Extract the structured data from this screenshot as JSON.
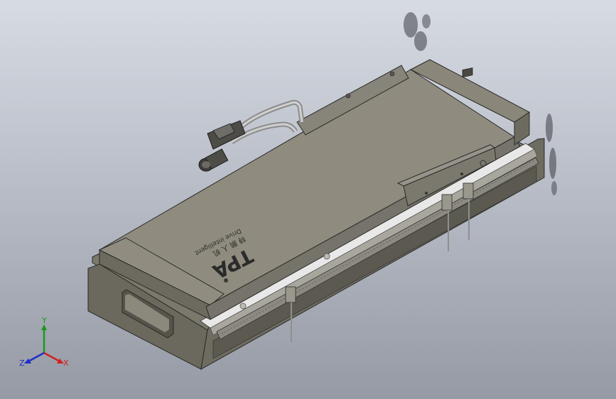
{
  "model": {
    "logo_lines": [
      "TPA",
      "特 鹏 人 机",
      "Drive intelligent"
    ],
    "colors": {
      "body_top": "#8f8c7f",
      "body_side": "#6d6a5f",
      "body_front": "#5d5a50",
      "rail": "#e6e6e6"
    }
  },
  "triad": {
    "x_label": "X",
    "y_label": "Y",
    "z_label": "Z",
    "colors": {
      "x": "#d42020",
      "y": "#1a9a1a",
      "z": "#2030c8"
    }
  }
}
